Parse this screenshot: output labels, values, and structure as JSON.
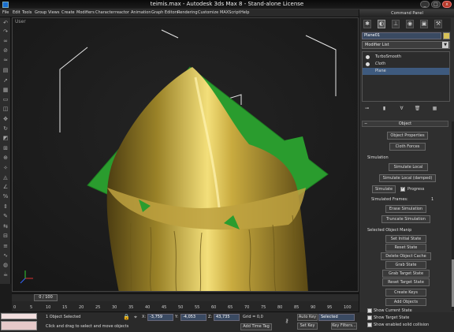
{
  "window": {
    "title": "teimis.max - Autodesk 3ds Max 8 - Stand-alone License",
    "minimize": "_",
    "maximize": "□",
    "close": "x"
  },
  "menu": [
    "File",
    "Edit",
    "Tools",
    "Group",
    "Views",
    "Create",
    "Modifiers",
    "Character",
    "reactor",
    "Animation",
    "Graph Editors",
    "Rendering",
    "Customize",
    "MAXScript",
    "Help"
  ],
  "viewport": {
    "label": "User",
    "colors": {
      "cloth": "#c8a83c",
      "plane": "#2a9c2e",
      "lines": "#e6e6e6"
    }
  },
  "timeline": {
    "slider": "0 / 100",
    "ticks": [
      "0",
      "5",
      "10",
      "15",
      "20",
      "25",
      "30",
      "35",
      "40",
      "45",
      "50",
      "55",
      "60",
      "65",
      "70",
      "75",
      "80",
      "85",
      "90",
      "95",
      "100"
    ]
  },
  "status": {
    "selection": "1 Object Selected",
    "prompt": "Click and drag to select and move objects",
    "x_label": "X:",
    "x_value": "-3,759",
    "y_label": "Y:",
    "y_value": "-4,053",
    "z_label": "Z:",
    "z_value": "43,735",
    "grid": "Grid = 0,0",
    "add_time_tag": "Add Time Tag",
    "auto_key": "Auto Key",
    "auto_key_mode": "Selected",
    "set_key": "Set Key",
    "key_filters": "Key Filters..."
  },
  "command_panel": {
    "header": "Command Panel",
    "tabs": [
      "create-tab",
      "modify-tab",
      "hierarchy-tab",
      "motion-tab",
      "display-tab",
      "utilities-tab"
    ],
    "object_name": "Plane01",
    "object_color": "#d8c257",
    "modifier_list": "Modifier List",
    "stack": [
      "TurboSmooth",
      "Cloth",
      "Plane"
    ],
    "rollout_title": "Object",
    "buttons": {
      "object_properties": "Object Properties",
      "cloth_forces": "Cloth Forces",
      "simulate_local": "Simulate Local",
      "simulate_local_damped": "Simulate Local (damped)",
      "simulate": "Simulate",
      "erase_simulation": "Erase Simulation",
      "truncate_simulation": "Truncate Simulation",
      "set_initial_state": "Set Initial State",
      "reset_state": "Reset State",
      "delete_object_cache": "Delete Object Cache",
      "grab_state": "Grab State",
      "grab_target_state": "Grab Target State",
      "reset_target_state": "Reset Target State",
      "create_keys": "Create Keys",
      "add_objects": "Add Objects"
    },
    "labels": {
      "simulation": "Simulation",
      "progress": "Progress",
      "simulated_frames": "Simulated Frames:",
      "simulated_frames_value": "1",
      "selected_object_manip": "Selected Object Manip",
      "show_current_state": "Show Current State",
      "show_target_state": "Show Target State",
      "show_enabled_solid_collision": "Show enabled solid collision"
    }
  }
}
